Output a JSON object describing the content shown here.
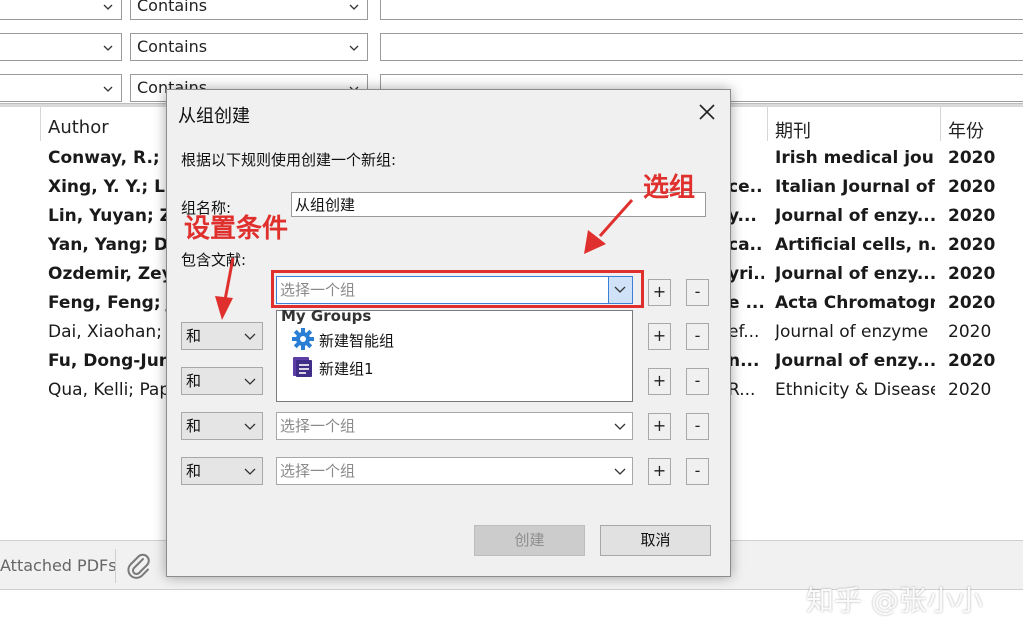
{
  "search_rows": [
    {
      "operator": "Contains"
    },
    {
      "operator": "Contains"
    },
    {
      "operator": "Contains"
    }
  ],
  "table": {
    "headers": {
      "author": "Author",
      "journal": "期刊",
      "year": "年份"
    },
    "rows": [
      {
        "author": "Conway, R.; O",
        "mid": "",
        "journal": "Irish medical jou...",
        "year": "2020",
        "bold": true
      },
      {
        "author": "Xing, Y. Y.; Li, I",
        "mid": "ce...",
        "journal": "Italian Journal of...",
        "year": "2020",
        "bold": true
      },
      {
        "author": "Lin, Yuyan; Zh",
        "mid": "y...",
        "journal": "Journal of enzy...",
        "year": "2020",
        "bold": true
      },
      {
        "author": "Yan, Yang; Du,",
        "mid": "ca...",
        "journal": "Artificial cells, n...",
        "year": "2020",
        "bold": true
      },
      {
        "author": "Ozdemir, Zeyn",
        "mid": "yri...",
        "journal": "Journal of enzy...",
        "year": "2020",
        "bold": true
      },
      {
        "author": "Feng, Feng; Jia",
        "mid": "e ...",
        "journal": "Acta Chromatogr...",
        "year": "2020",
        "bold": true
      },
      {
        "author": "Dai, Xiaohan; S",
        "mid": "ef...",
        "journal": "Journal of enzyme ...",
        "year": "2020",
        "bold": false
      },
      {
        "author": "Fu, Dong-Jun;",
        "mid": "n...",
        "journal": "Journal of enzy...",
        "year": "2020",
        "bold": true
      },
      {
        "author": "Qua, Kelli; Papp",
        "mid": "R...",
        "journal": "Ethnicity & Disease",
        "year": "2020",
        "bold": false
      }
    ]
  },
  "bottom_bar": {
    "attached_pdfs": "Attached PDFs"
  },
  "dialog": {
    "title": "从组创建",
    "instruction": "根据以下规则使用创建一个新组:",
    "group_name_label": "组名称:",
    "group_name_value": "从组创建",
    "include_label": "包含文献:",
    "rules": [
      {
        "connector": "",
        "group": "选择一个组"
      },
      {
        "connector": "和",
        "group": ""
      },
      {
        "connector": "和",
        "group": ""
      },
      {
        "connector": "和",
        "group": "选择一个组"
      },
      {
        "connector": "和",
        "group": "选择一个组"
      }
    ],
    "plus": "+",
    "minus": "-",
    "dropdown": {
      "header": "My Groups",
      "items": [
        {
          "label": "新建智能组",
          "icon": "smart-group-gear-icon"
        },
        {
          "label": "新建组1",
          "icon": "group-list-icon"
        }
      ]
    },
    "create_button": "创建",
    "cancel_button": "取消"
  },
  "annotations": {
    "set_condition": "设置条件",
    "select_group": "选组",
    "color": "#e0302e"
  },
  "watermark": "知乎 @张小小"
}
